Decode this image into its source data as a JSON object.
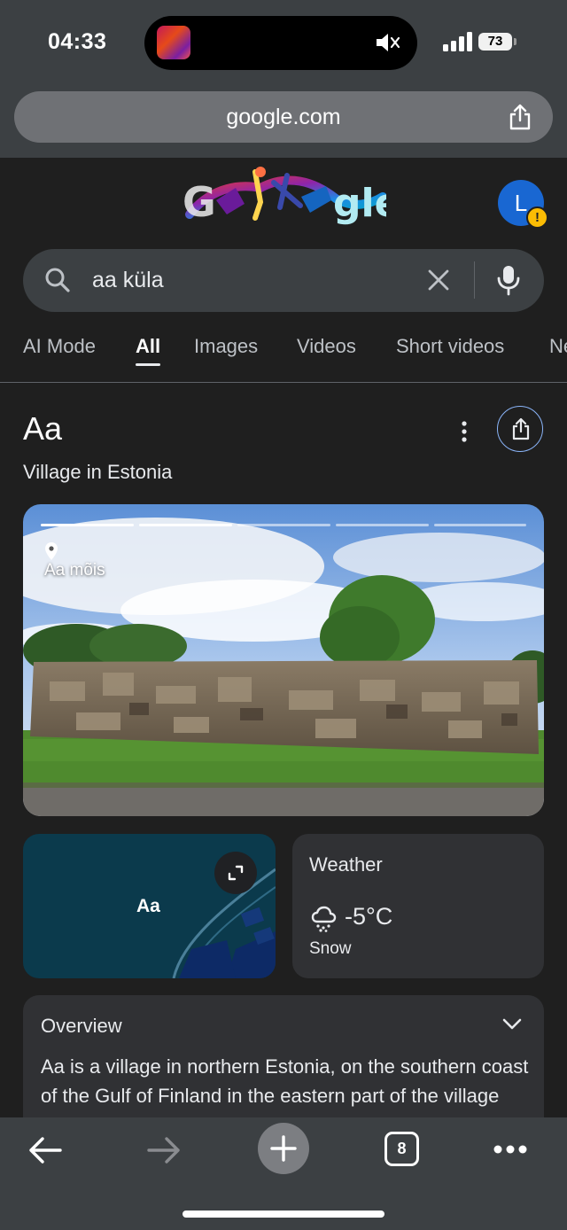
{
  "status_bar": {
    "time": "04:33",
    "battery": "73"
  },
  "browser": {
    "url": "google.com",
    "open_tabs": "8"
  },
  "account": {
    "initial": "L",
    "badge": "!"
  },
  "search": {
    "query": "aa küla"
  },
  "tabs": [
    {
      "label": "AI Mode",
      "active": false
    },
    {
      "label": "All",
      "active": true
    },
    {
      "label": "Images",
      "active": false
    },
    {
      "label": "Videos",
      "active": false
    },
    {
      "label": "Short videos",
      "active": false
    },
    {
      "label": "News",
      "active": false
    }
  ],
  "knowledge_panel": {
    "title": "Aa",
    "subtitle": "Village in Estonia",
    "photo_label": "Aa mõis",
    "photo_progress": {
      "total": 5,
      "current": 2
    },
    "map_label": "Aa",
    "weather": {
      "title": "Weather",
      "temp": "-5°C",
      "condition": "Snow",
      "icon": "snow-cloud-icon"
    },
    "overview": {
      "title": "Overview",
      "text": "Aa is a village in northern Estonia, on the southern coast of the Gulf of Finland in the eastern part of the village centre, right of the Lüganuse Parish of"
    }
  },
  "colors": {
    "accent": "#8ab4f8",
    "avatar": "#1967d2",
    "badge": "#fbbc04",
    "map": "#0b3a4c"
  }
}
